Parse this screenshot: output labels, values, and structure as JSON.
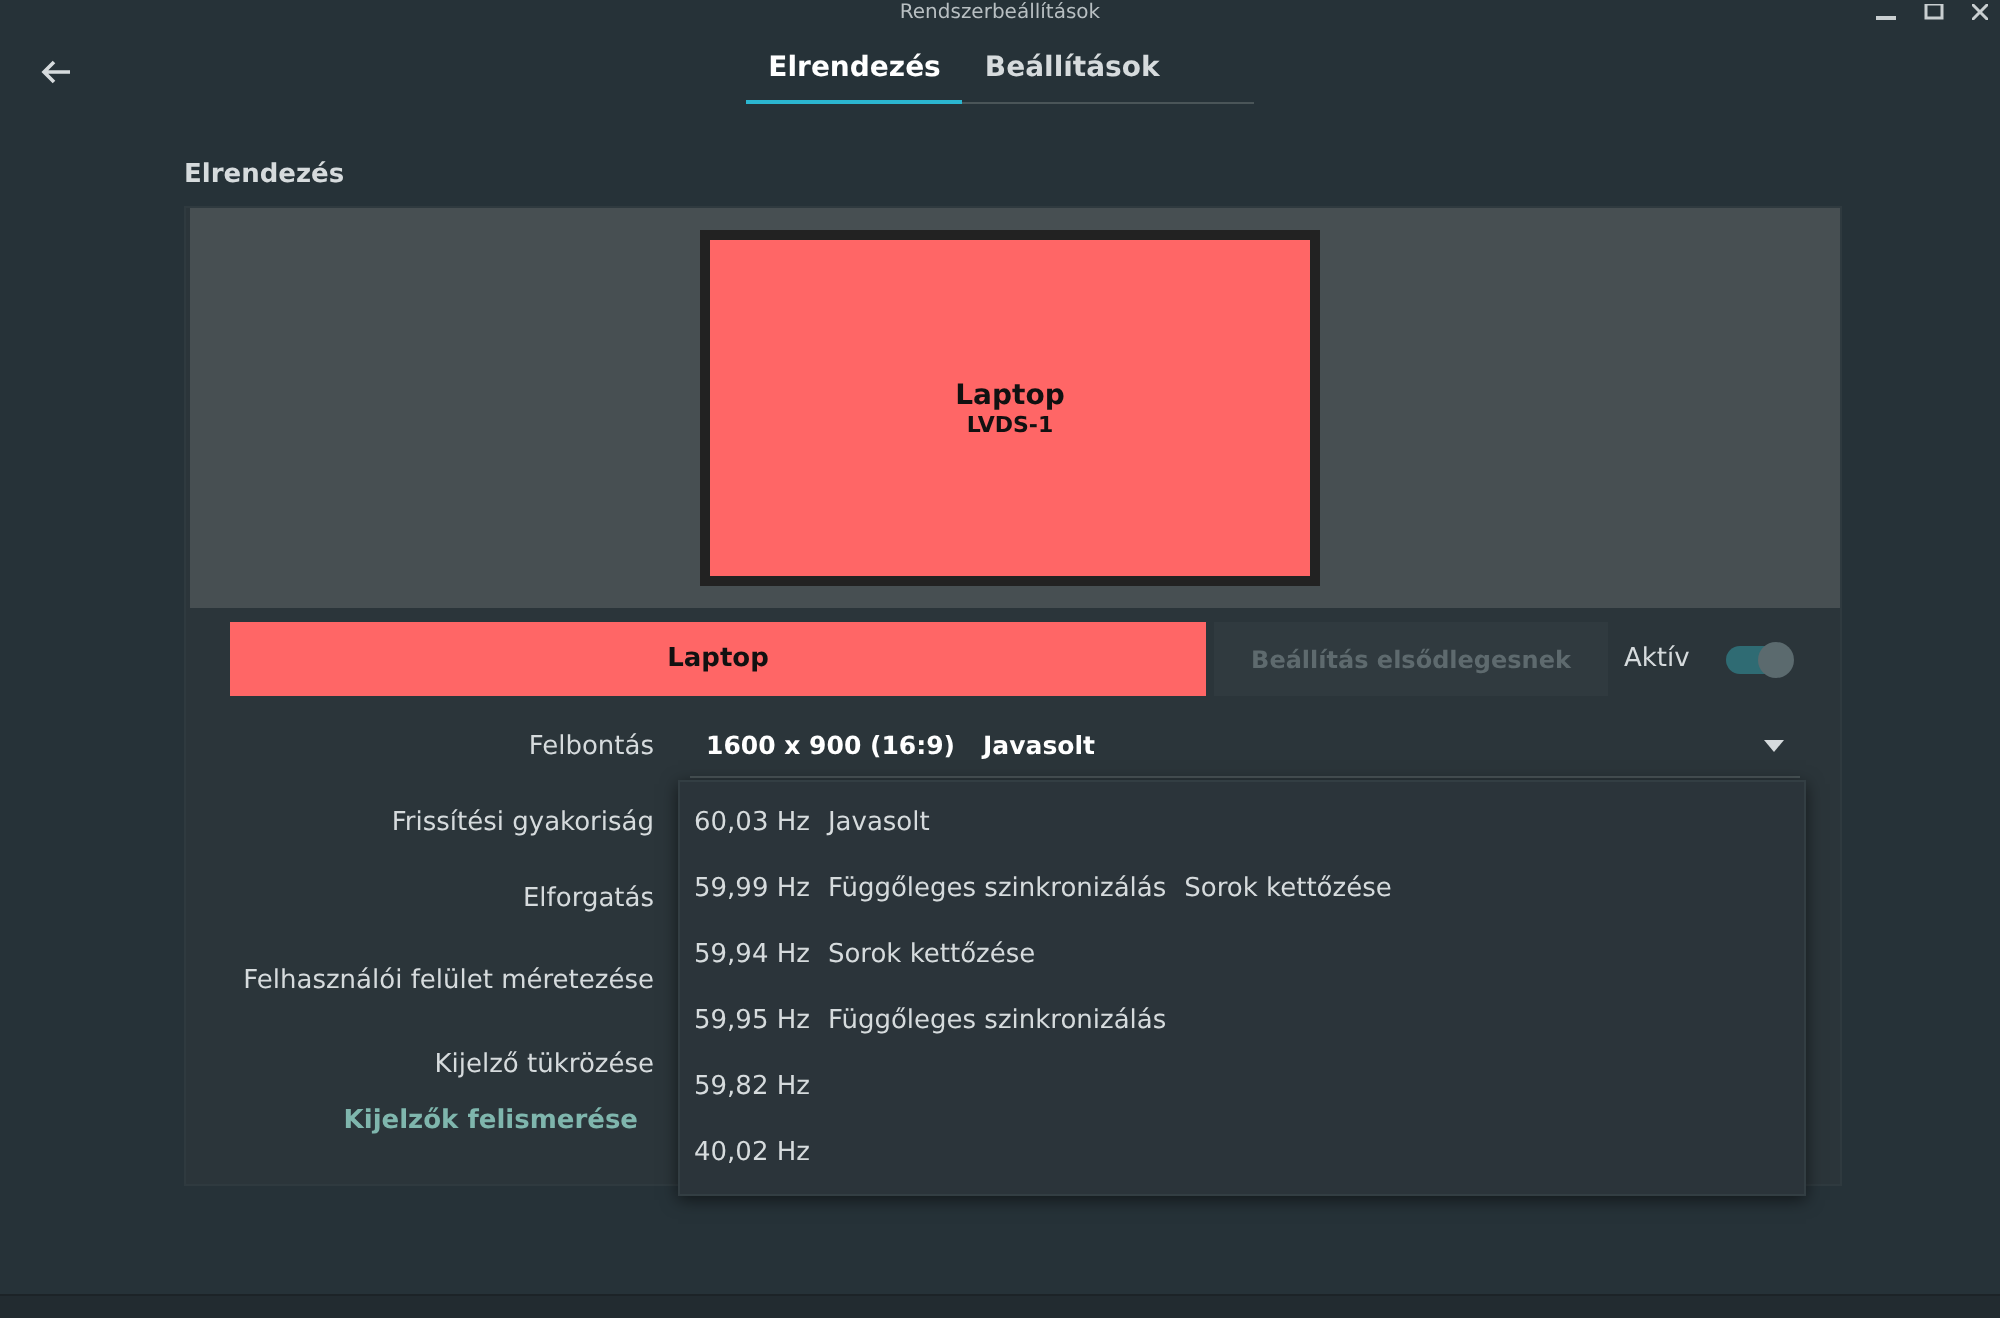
{
  "window": {
    "title": "Rendszerbeállítások"
  },
  "tabs": [
    {
      "label": "Elrendezés",
      "selected": true
    },
    {
      "label": "Beállítások",
      "selected": false
    }
  ],
  "section_title": "Elrendezés",
  "display": {
    "name": "Laptop",
    "connector": "LVDS-1",
    "color": "#ff6666"
  },
  "display_bar": {
    "name": "Laptop",
    "primary_button": "Beállítás elsődlegesnek",
    "primary_disabled": true,
    "active_label": "Aktív",
    "active_on": true
  },
  "settings": [
    {
      "label": "Felbontás",
      "value": "1600 x 900 (16:9)",
      "note": "Javasolt"
    },
    {
      "label": "Frissítési gyakoriság"
    },
    {
      "label": "Elforgatás"
    },
    {
      "label": "Felhasználói felület méretezése"
    },
    {
      "label": "Kijelző tükrözése"
    }
  ],
  "detect_link": "Kijelzők felismerése",
  "refresh_menu": [
    {
      "rate": "60,03 Hz",
      "tags": [
        "Javasolt"
      ]
    },
    {
      "rate": "59,99 Hz",
      "tags": [
        "Függőleges szinkronizálás",
        "Sorok kettőzése"
      ]
    },
    {
      "rate": "59,94 Hz",
      "tags": [
        "Sorok kettőzése"
      ]
    },
    {
      "rate": "59,95 Hz",
      "tags": [
        "Függőleges szinkronizálás"
      ]
    },
    {
      "rate": "59,82 Hz"
    },
    {
      "rate": "40,02 Hz"
    }
  ]
}
